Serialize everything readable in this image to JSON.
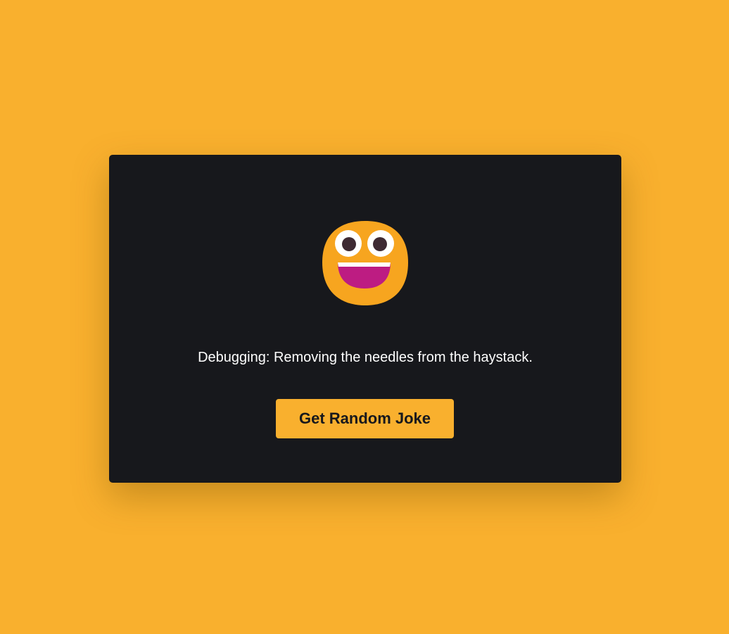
{
  "card": {
    "emoji_icon": "grinning-face-big-eyes-icon",
    "joke_text": "Debugging: Removing the needles from the haystack.",
    "button_label": "Get Random Joke"
  },
  "colors": {
    "background": "#f9b02e",
    "card": "#17181c",
    "button": "#f9b02e",
    "button_text": "#17181c",
    "joke_text": "#ffffff"
  }
}
